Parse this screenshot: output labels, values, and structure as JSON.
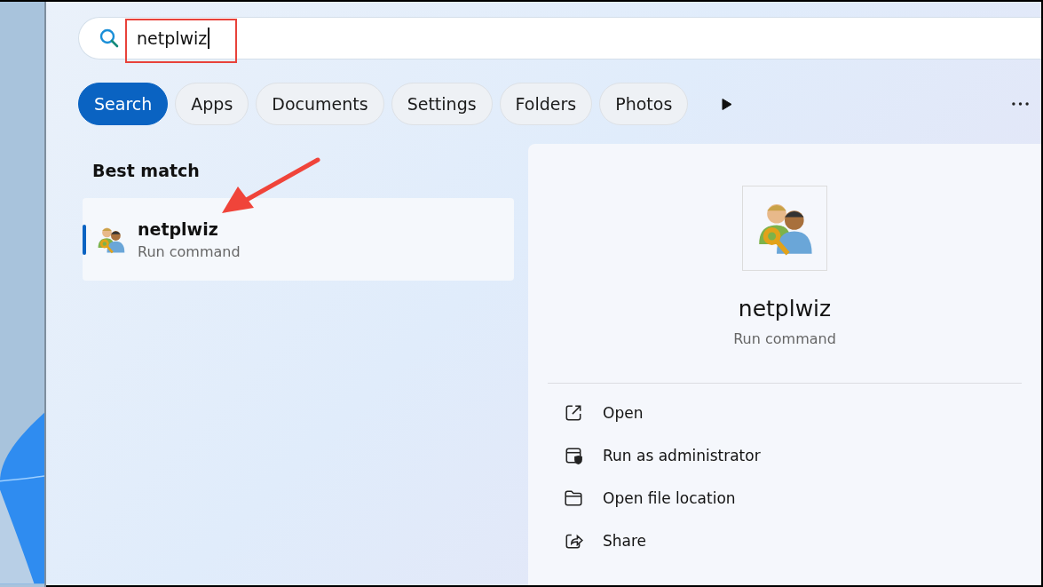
{
  "search": {
    "value": "netplwiz"
  },
  "filters": [
    {
      "label": "Search",
      "selected": true
    },
    {
      "label": "Apps",
      "selected": false
    },
    {
      "label": "Documents",
      "selected": false
    },
    {
      "label": "Settings",
      "selected": false
    },
    {
      "label": "Folders",
      "selected": false
    },
    {
      "label": "Photos",
      "selected": false
    }
  ],
  "best_match": {
    "heading": "Best match",
    "title": "netplwiz",
    "subtitle": "Run command",
    "selected": true
  },
  "details": {
    "title": "netplwiz",
    "subtitle": "Run command",
    "actions": [
      {
        "kind": "open",
        "label": "Open"
      },
      {
        "kind": "admin",
        "label": "Run as administrator"
      },
      {
        "kind": "folder",
        "label": "Open file location"
      },
      {
        "kind": "share",
        "label": "Share"
      }
    ]
  }
}
